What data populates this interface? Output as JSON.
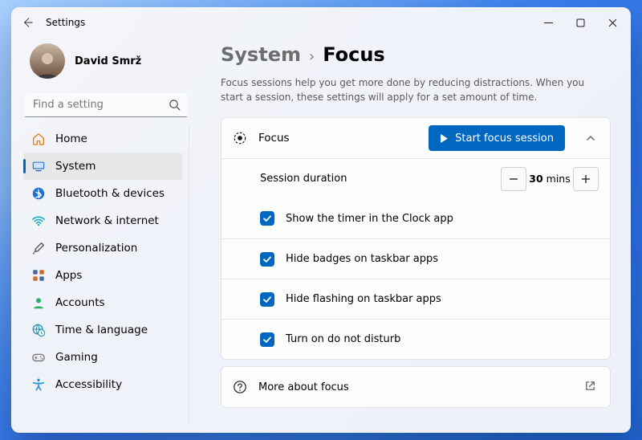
{
  "titlebar": {
    "title": "Settings"
  },
  "profile": {
    "name": "David Smrž"
  },
  "search": {
    "placeholder": "Find a setting"
  },
  "sidebar": {
    "items": [
      {
        "id": "home",
        "label": "Home",
        "icon": "home-icon",
        "selected": false,
        "color": "#e08a2c"
      },
      {
        "id": "system",
        "label": "System",
        "icon": "system-icon",
        "selected": true,
        "color": "#1f6fd0"
      },
      {
        "id": "bluetooth",
        "label": "Bluetooth & devices",
        "icon": "bluetooth-icon",
        "selected": false,
        "color": "#1f6fd0"
      },
      {
        "id": "network",
        "label": "Network & internet",
        "icon": "wifi-icon",
        "selected": false,
        "color": "#16b1c7"
      },
      {
        "id": "personalization",
        "label": "Personalization",
        "icon": "brush-icon",
        "selected": false,
        "color": "#5a5a5a"
      },
      {
        "id": "apps",
        "label": "Apps",
        "icon": "apps-icon",
        "selected": false,
        "color": "#4666a0"
      },
      {
        "id": "accounts",
        "label": "Accounts",
        "icon": "person-icon",
        "selected": false,
        "color": "#2cb36b"
      },
      {
        "id": "time",
        "label": "Time & language",
        "icon": "globe-clock-icon",
        "selected": false,
        "color": "#2a9bb8"
      },
      {
        "id": "gaming",
        "label": "Gaming",
        "icon": "gamepad-icon",
        "selected": false,
        "color": "#808080"
      },
      {
        "id": "accessibility",
        "label": "Accessibility",
        "icon": "accessibility-icon",
        "selected": false,
        "color": "#1f8fd0"
      }
    ]
  },
  "breadcrumb": {
    "root": "System",
    "leaf": "Focus"
  },
  "description": "Focus sessions help you get more done by reducing distractions. When you start a session, these settings will apply for a set amount of time.",
  "focus_card": {
    "title": "Focus",
    "button": "Start focus session",
    "duration_label": "Session duration",
    "duration_value": "30",
    "duration_unit": "mins",
    "options": [
      {
        "label": "Show the timer in the Clock app",
        "checked": true
      },
      {
        "label": "Hide badges on taskbar apps",
        "checked": true
      },
      {
        "label": "Hide flashing on taskbar apps",
        "checked": true
      },
      {
        "label": "Turn on do not disturb",
        "checked": true
      }
    ]
  },
  "more_card": {
    "label": "More about focus"
  }
}
